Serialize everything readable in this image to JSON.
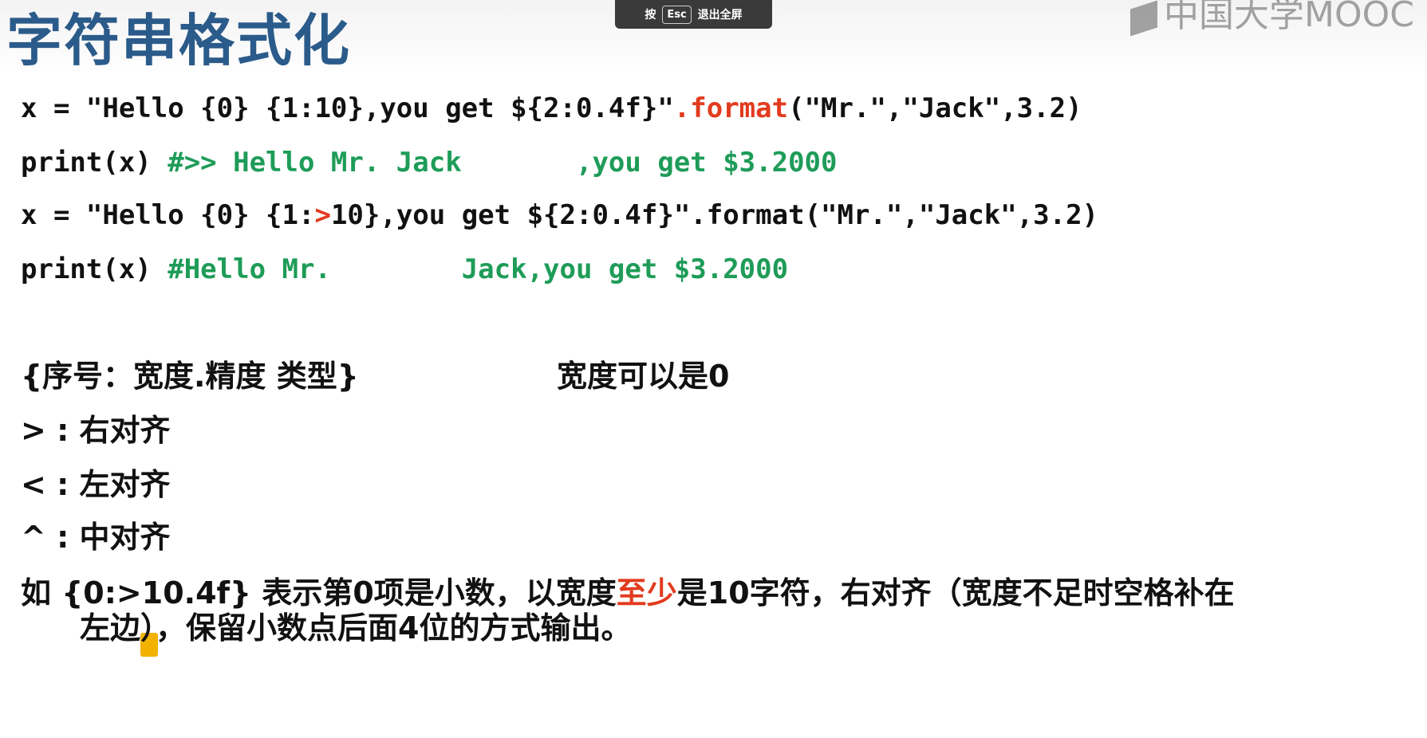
{
  "slide": {
    "title": "字符串格式化",
    "fullscreen_bar": {
      "press": "按",
      "key": "Esc",
      "exit": "退出全屏"
    },
    "logo_text": "中国大学MOOC",
    "code_lines": [
      {
        "prefix": "x = \"Hello {0} {1:10},you get ${2:0.4f}\"",
        "method": ".format",
        "args": "(\"Mr.\",\"Jack\",3.2)"
      },
      {
        "code": "print(x) ",
        "comment": "#>> Hello Mr. Jack       ,you get $3.2000"
      },
      {
        "part1": "x = \"Hello {0} {1:",
        "align": ">",
        "part2": "10},you get ${2:0.4f}\".format(\"Mr.\",\"Jack\",3.2)"
      },
      {
        "code": "print(x) ",
        "comment": "#Hello Mr.        Jack,you get $3.2000"
      }
    ],
    "spec_line": {
      "left": "{序号：宽度.精度 类型}",
      "right": "宽度可以是0"
    },
    "align_rules": [
      {
        "symbol": ">",
        "sep": " : ",
        "desc": "右对齐"
      },
      {
        "symbol": "<",
        "sep": " : ",
        "desc": "左对齐"
      },
      {
        "symbol": "^",
        "sep": " : ",
        "desc": "中对齐"
      }
    ],
    "example": {
      "line1_a": "如 {0:>10.4f} 表示第0项是小数，以宽度",
      "line1_red": "至少",
      "line1_b": "是10字符，右对齐（宽度不足时空格补在",
      "line2": "左边），保留小数点后面4位的方式输出。"
    }
  }
}
